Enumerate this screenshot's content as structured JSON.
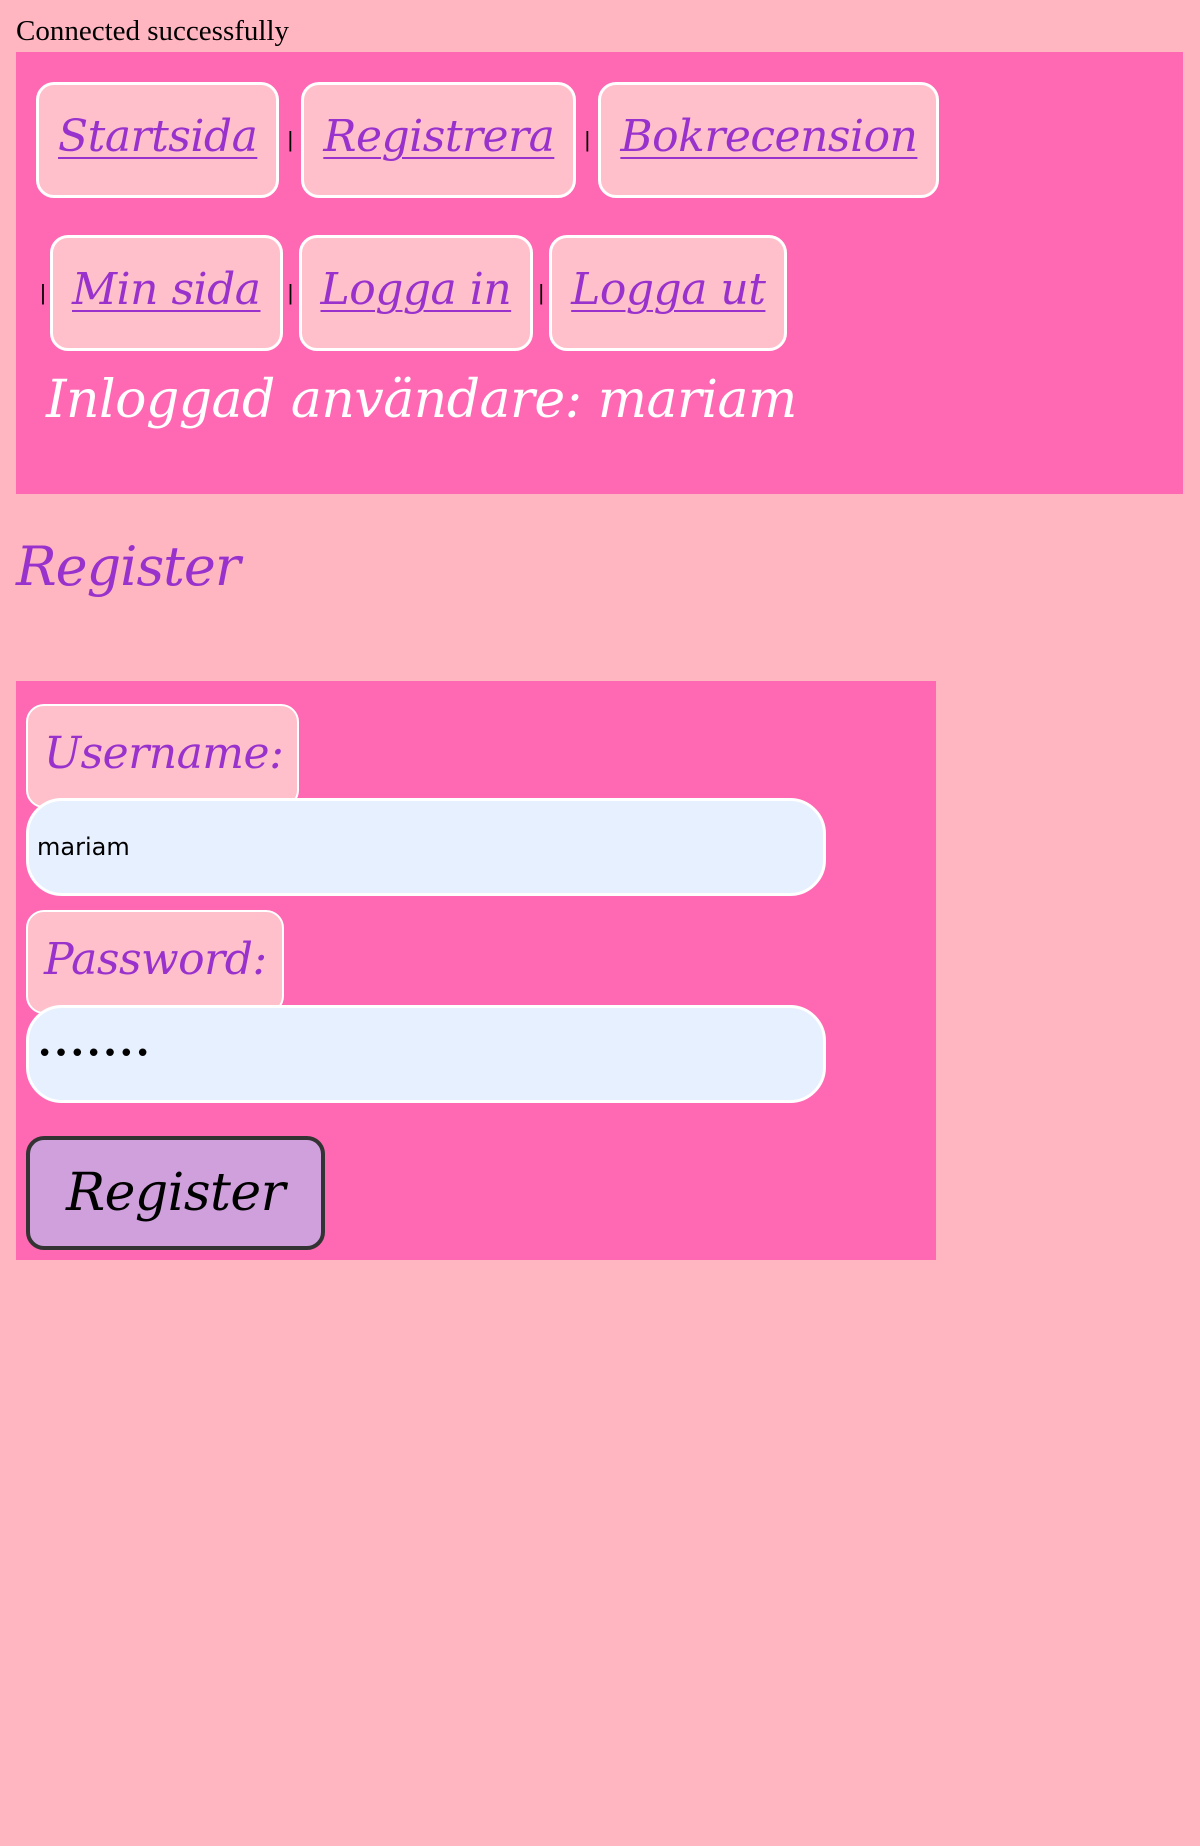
{
  "status": {
    "message": "Connected successfully"
  },
  "nav": {
    "row1": [
      {
        "label": "Startsida"
      },
      {
        "label": "Registrera "
      },
      {
        "label": "Bokrecension"
      }
    ],
    "row2": [
      {
        "label": "Min sida "
      },
      {
        "label": "Logga in "
      },
      {
        "label": "Logga ut"
      }
    ],
    "separator": "|"
  },
  "session": {
    "logged_in_text": "Inloggad användare: mariam"
  },
  "page": {
    "heading": "Register"
  },
  "form": {
    "username_label": "Username:",
    "username_value": "mariam",
    "password_label": "Password:",
    "password_value": "•••••••",
    "submit_label": "Register"
  },
  "colors": {
    "page_background": "#ffb6c1",
    "panel_background": "#ff69b4",
    "button_background": "#ffc0cb",
    "link_color": "#9932cc",
    "input_background": "#e6f0ff",
    "submit_background": "#cfa0dc"
  }
}
